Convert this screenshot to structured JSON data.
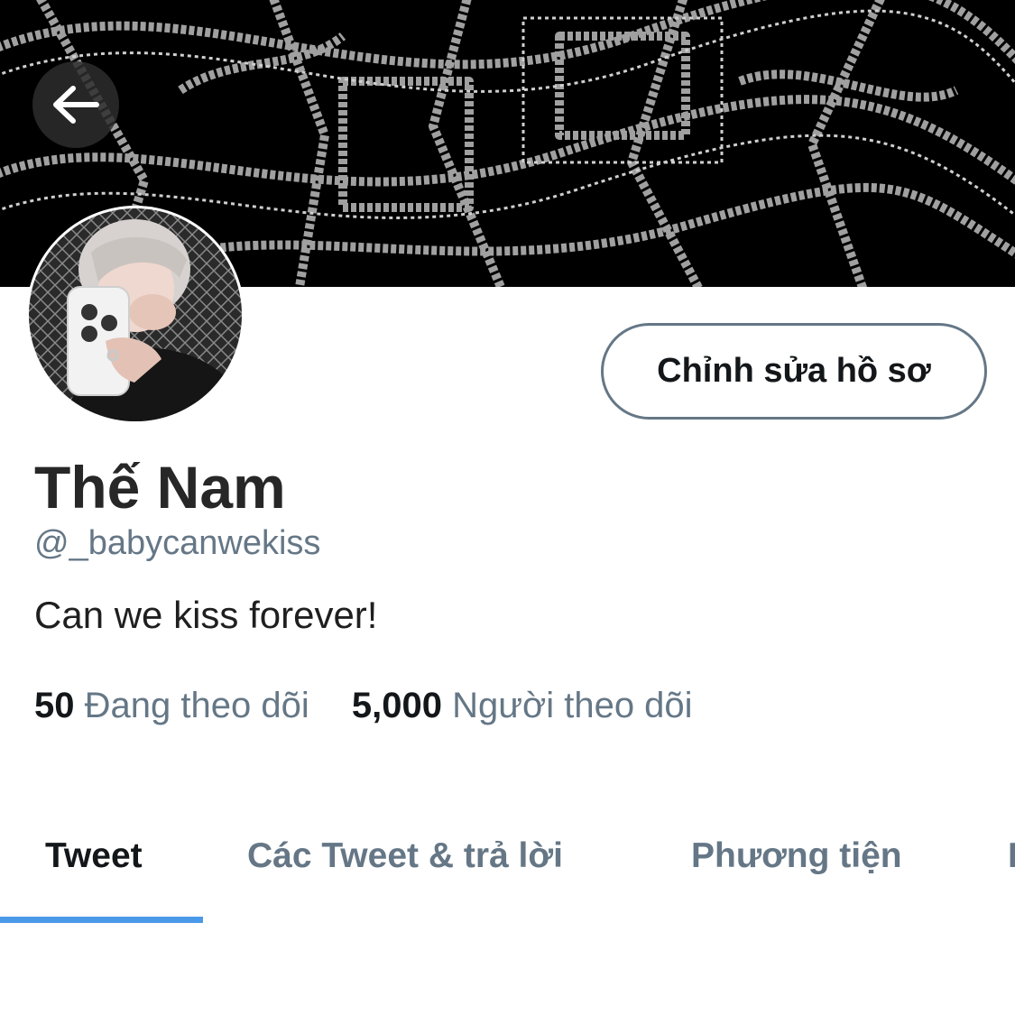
{
  "header": {
    "back_icon": "arrow-left-icon",
    "banner_colors": {
      "background": "#000000",
      "pattern": "#9a9a9a"
    }
  },
  "profile": {
    "display_name": "Thế Nam",
    "handle": "@_babycanwekiss",
    "bio": "Can we kiss forever!",
    "edit_label": "Chỉnh sửa hồ sơ"
  },
  "stats": {
    "following_count": "50",
    "following_label": "Đang theo dõi",
    "followers_count": "5,000",
    "followers_label": "Người theo dõi"
  },
  "tabs": [
    {
      "label": "Tweet",
      "active": true
    },
    {
      "label": "Các Tweet & trả lời",
      "active": false
    },
    {
      "label": "Phương tiện",
      "active": false
    },
    {
      "label": "L",
      "active": false
    }
  ],
  "colors": {
    "accent": "#4a99e9",
    "muted": "#657786"
  }
}
